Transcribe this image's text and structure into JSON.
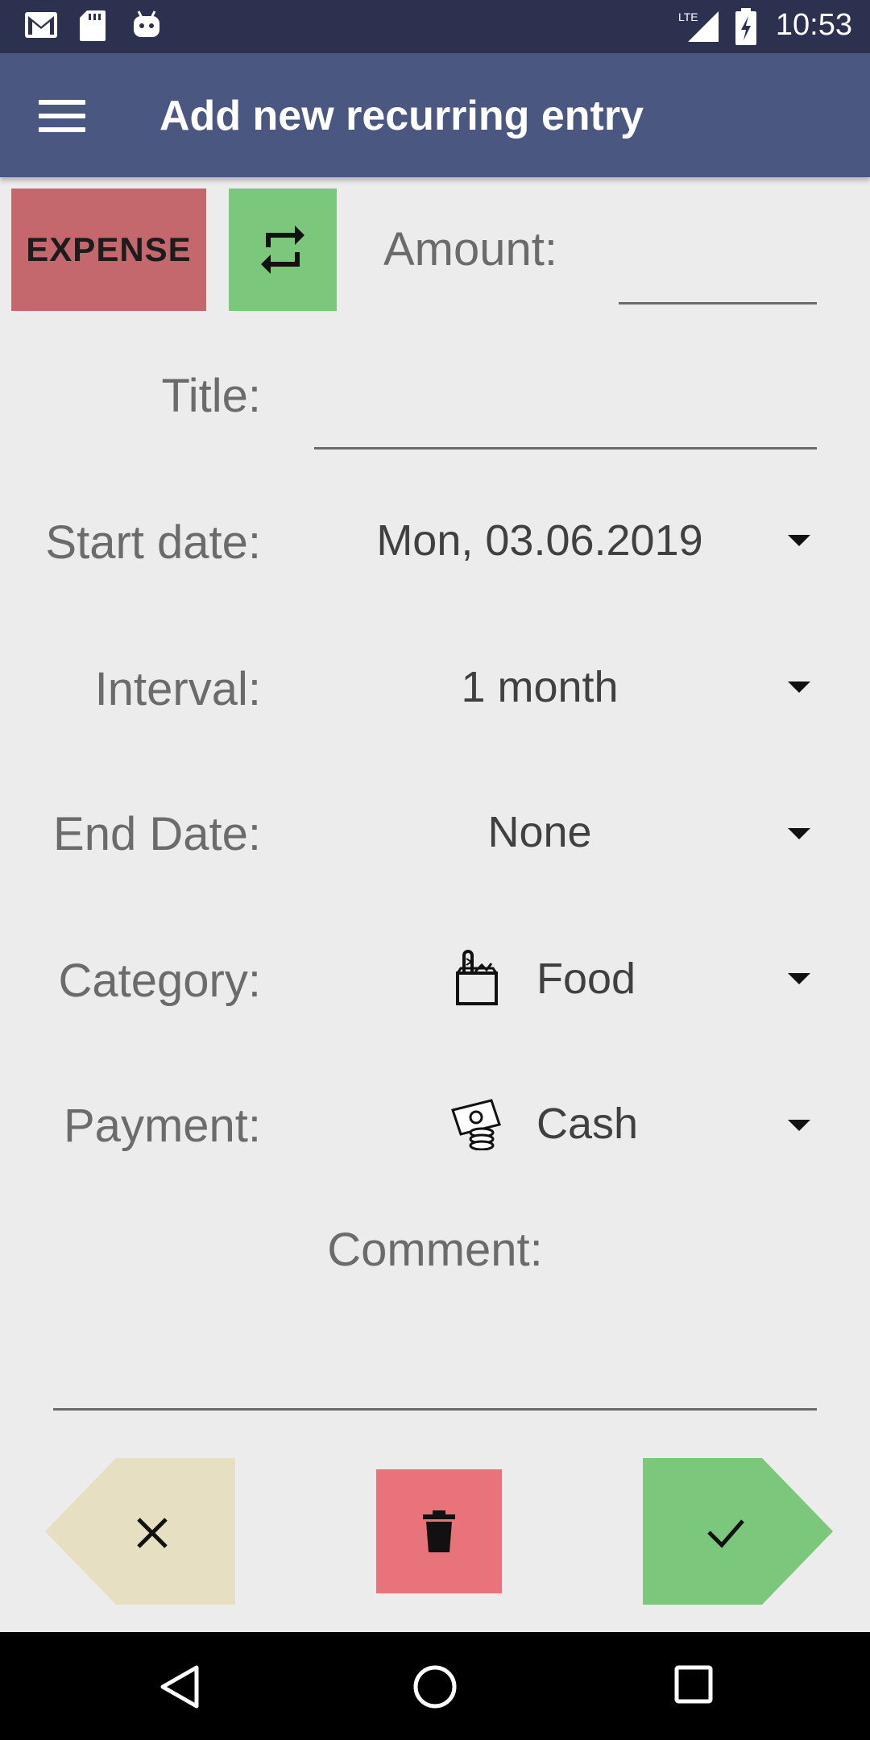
{
  "status_bar": {
    "time": "10:53",
    "network": "LTE",
    "icons": [
      "gmail-icon",
      "sd-card-icon",
      "android-icon",
      "lte-signal-icon",
      "battery-charging-icon"
    ]
  },
  "app_bar": {
    "title": "Add new recurring entry",
    "menu_icon": "hamburger-menu-icon"
  },
  "form": {
    "type_toggle": "EXPENSE",
    "repeat_icon": "repeat-icon",
    "amount": {
      "label": "Amount:",
      "value": ""
    },
    "title": {
      "label": "Title:",
      "value": ""
    },
    "start_date": {
      "label": "Start date:",
      "value": "Mon, 03.06.2019"
    },
    "interval": {
      "label": "Interval:",
      "value": "1 month"
    },
    "end_date": {
      "label": "End Date:",
      "value": "None"
    },
    "category": {
      "label": "Category:",
      "value": "Food",
      "icon": "grocery-bag-icon"
    },
    "payment": {
      "label": "Payment:",
      "value": "Cash",
      "icon": "cash-icon"
    },
    "comment": {
      "label": "Comment:",
      "value": ""
    }
  },
  "actions": {
    "cancel_icon": "close-icon",
    "delete_icon": "trash-icon",
    "confirm_icon": "check-icon"
  },
  "colors": {
    "status_bar": "#2c3150",
    "app_bar": "#4a5780",
    "background": "#ececec",
    "expense": "#c4686e",
    "repeat": "#7bc87c",
    "cancel": "#e6dfc2",
    "delete": "#e8737a",
    "confirm": "#7bc87c"
  }
}
